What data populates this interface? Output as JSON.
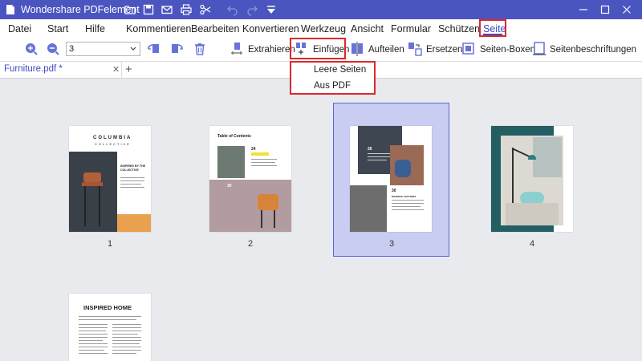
{
  "app": {
    "title": "Wondershare PDFelement"
  },
  "menu": {
    "items": [
      {
        "label": "Datei"
      },
      {
        "label": "Start"
      },
      {
        "label": "Hilfe"
      },
      {
        "label": "Kommentieren"
      },
      {
        "label": "Bearbeiten"
      },
      {
        "label": "Konvertieren"
      },
      {
        "label": "Werkzeug"
      },
      {
        "label": "Ansicht"
      },
      {
        "label": "Formular"
      },
      {
        "label": "Schützen"
      },
      {
        "label": "Seite"
      }
    ],
    "active": "Seite"
  },
  "toolbar": {
    "page_value": "3",
    "extract": "Extrahieren",
    "insert": "Einfügen",
    "split": "Aufteilen",
    "replace": "Ersetzen",
    "page_boxes": "Seiten-Boxen",
    "page_labels": "Seitenbeschriftungen"
  },
  "tabs": [
    {
      "label": "Furniture.pdf *"
    }
  ],
  "dropdown": {
    "items": [
      {
        "label": "Leere Seiten"
      },
      {
        "label": "Aus PDF"
      }
    ]
  },
  "pages": [
    {
      "number": "1",
      "selected": false
    },
    {
      "number": "2",
      "selected": false
    },
    {
      "number": "3",
      "selected": true
    },
    {
      "number": "4",
      "selected": false
    }
  ],
  "thumb_text": {
    "p1_title": "COLUMBIA",
    "p1_sub": "COLLECTIVE",
    "p1_heading": "INSPIRED BY THE COLLECTIVE",
    "p2_title": "Table of Contents",
    "p2_num1": "24",
    "p2_num2": "30",
    "p3_num1": "26",
    "p3_num2": "30",
    "p3_heading": "MATERIAL MATTERS",
    "p5_title": "INSPIRED HOME"
  },
  "colors": {
    "titlebar": "#4a55c0",
    "accent": "#3e49c4",
    "highlight": "#d92a2a",
    "selection": "#c9cdf1"
  }
}
